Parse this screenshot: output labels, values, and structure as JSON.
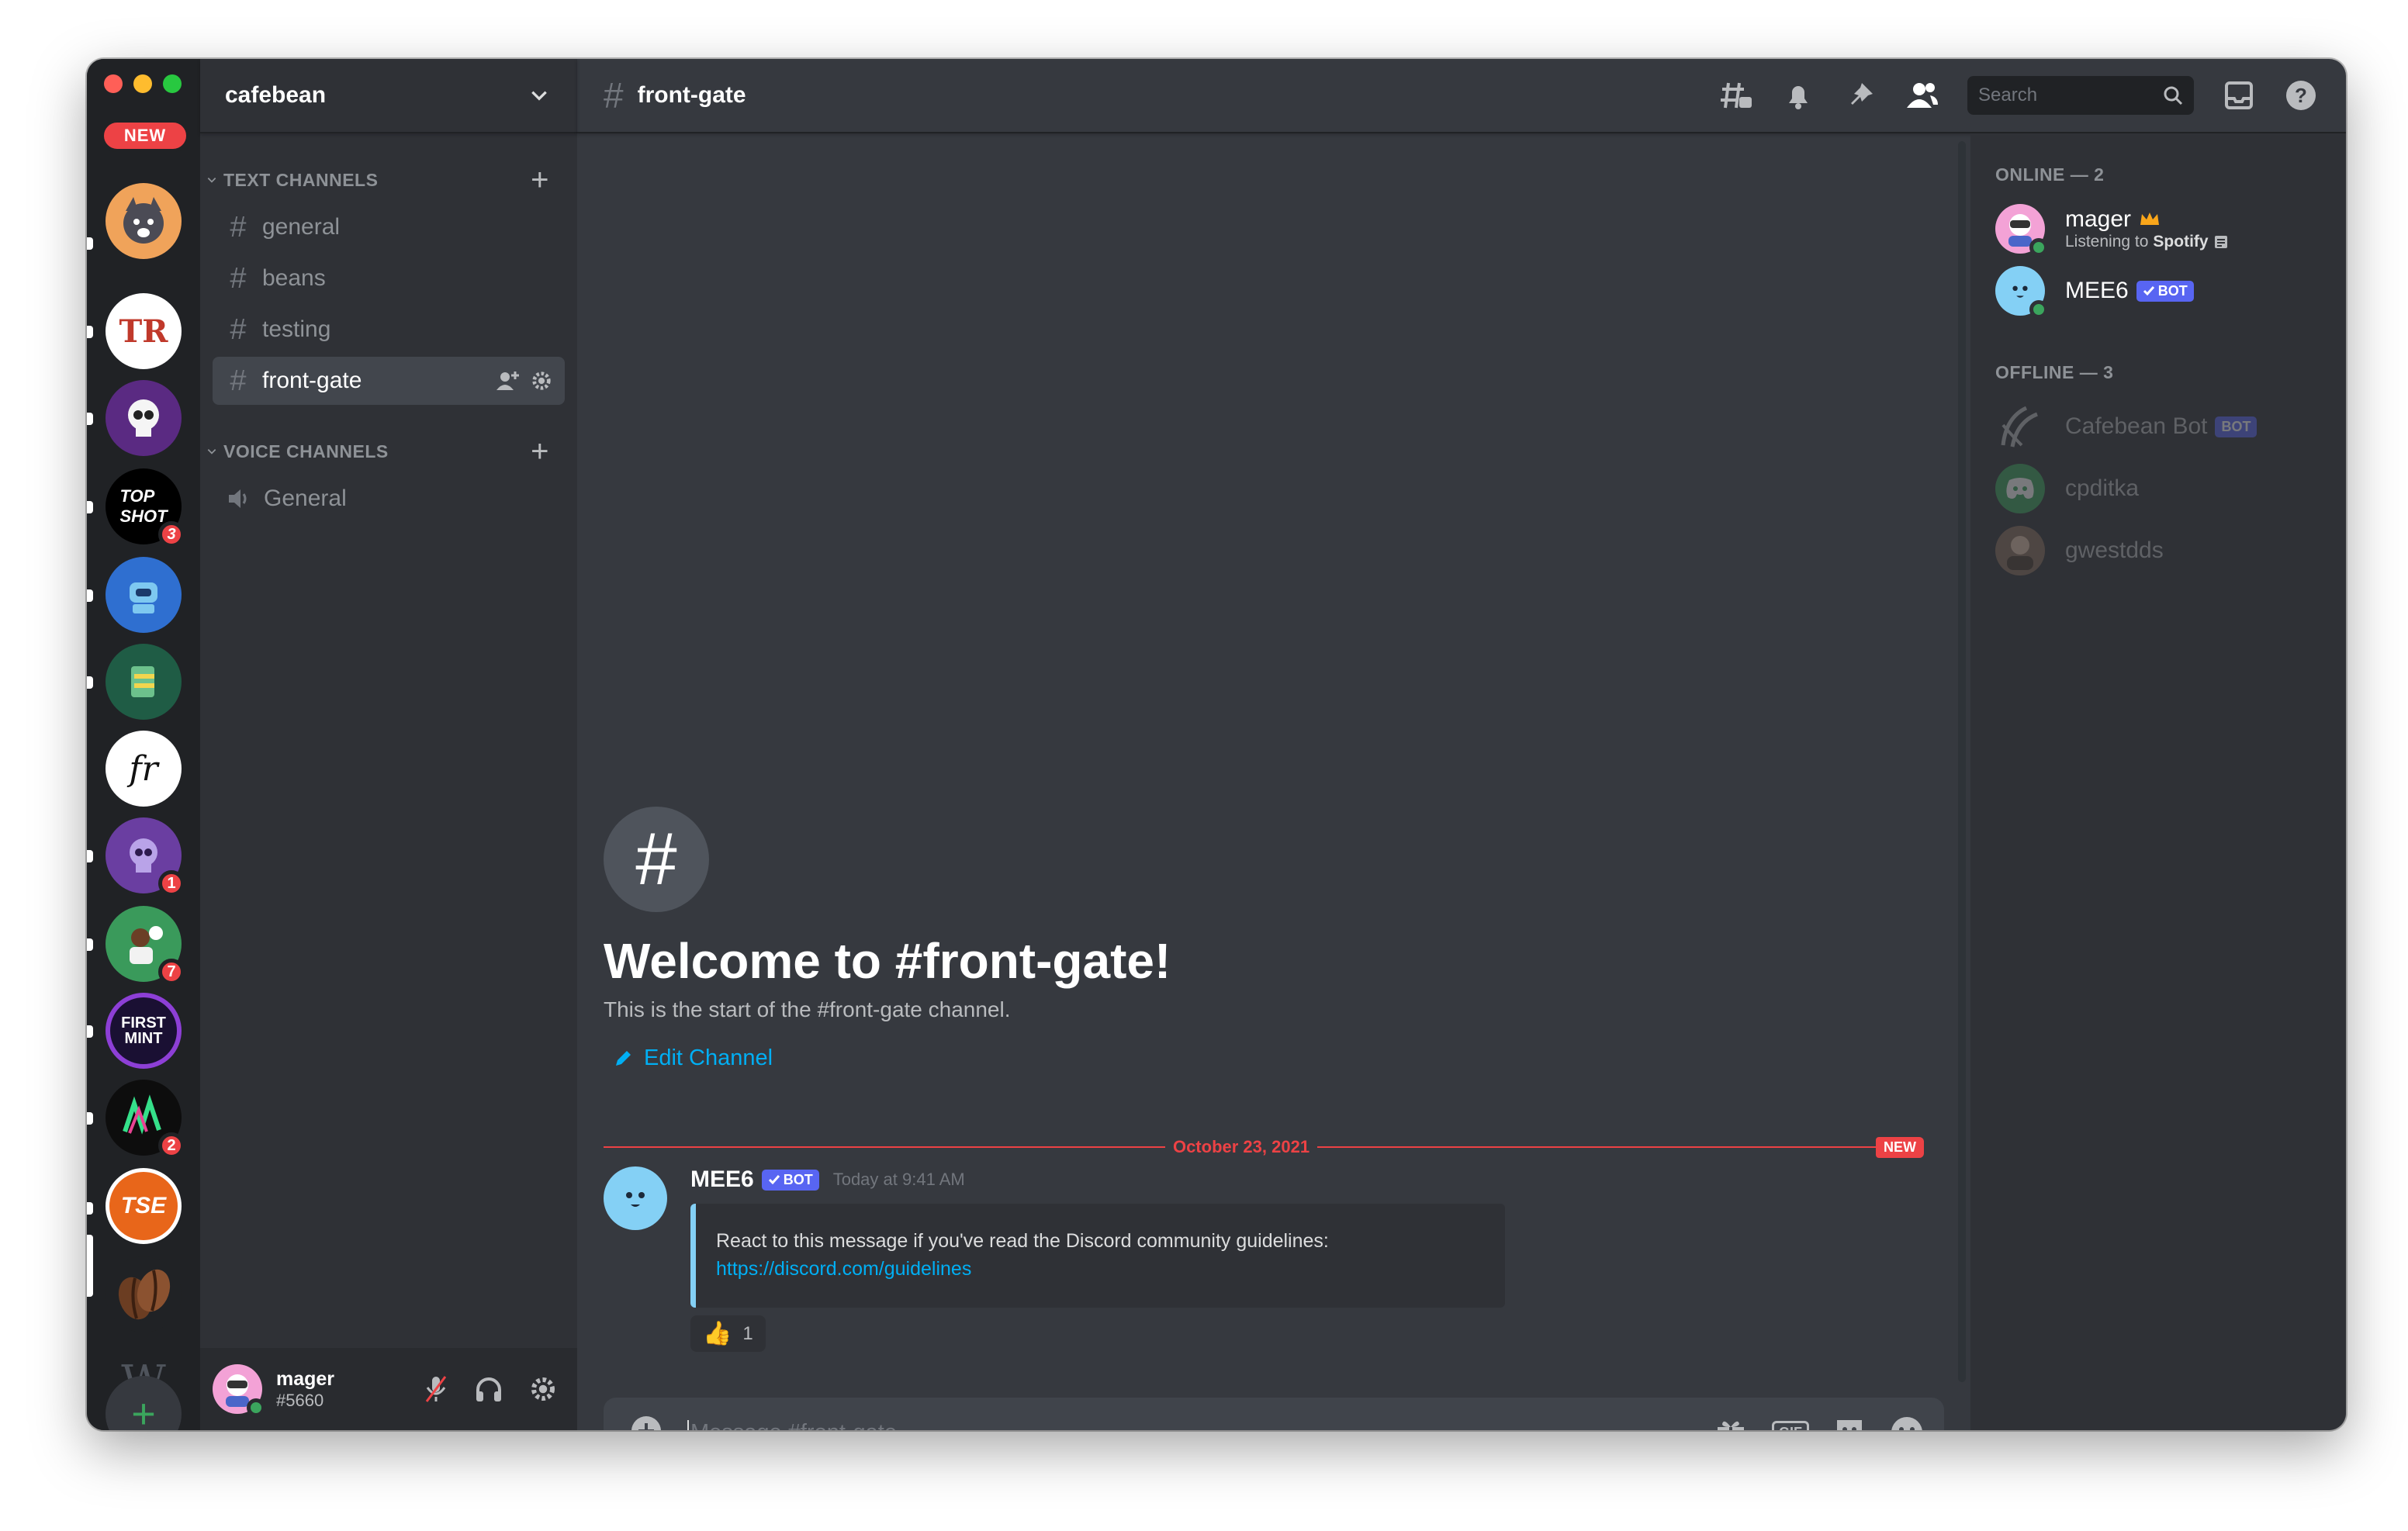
{
  "server": {
    "name": "cafebean"
  },
  "rail": {
    "new_label": "NEW",
    "badges": {
      "topshot": "3",
      "bluebot": "",
      "purple_skull": "1",
      "baller": "7",
      "neon": "2"
    }
  },
  "sidebar": {
    "text_category": "TEXT CHANNELS",
    "voice_category": "VOICE CHANNELS",
    "text_channels": [
      "general",
      "beans",
      "testing",
      "front-gate"
    ],
    "voice_channels": [
      "General"
    ],
    "active_channel": "front-gate"
  },
  "user_panel": {
    "username": "mager",
    "discriminator": "#5660"
  },
  "topbar": {
    "channel_name": "front-gate",
    "search_placeholder": "Search"
  },
  "welcome": {
    "title": "Welcome to #front-gate!",
    "subtitle": "This is the start of the #front-gate channel.",
    "edit_label": "Edit Channel"
  },
  "divider": {
    "date": "October 23, 2021",
    "new_label": "NEW"
  },
  "message": {
    "author": "MEE6",
    "bot_label": "BOT",
    "timestamp": "Today at 9:41 AM",
    "embed_text": "React to this message if you've read the Discord community guidelines:",
    "embed_link": "https://discord.com/guidelines",
    "reaction_count": "1"
  },
  "composer": {
    "placeholder": "Message #front-gate",
    "gif_label": "GIF"
  },
  "members": {
    "online_title": "ONLINE — 2",
    "offline_title": "OFFLINE — 3",
    "online": [
      {
        "name": "mager",
        "activity_prefix": "Listening to",
        "activity_name": "Spotify"
      },
      {
        "name": "MEE6",
        "bot_label": "BOT"
      }
    ],
    "offline": [
      {
        "name": "Cafebean Bot",
        "bot_label": "BOT"
      },
      {
        "name": "cpditka"
      },
      {
        "name": "gwestdds"
      }
    ]
  },
  "colors": {
    "blurple": "#5865f2",
    "danger": "#ed4245",
    "online": "#3ba55d",
    "link": "#00aff4",
    "mee6_blue": "#84d0f5",
    "bg_primary": "#36393f",
    "bg_secondary": "#2f3136",
    "bg_tertiary": "#202225"
  }
}
